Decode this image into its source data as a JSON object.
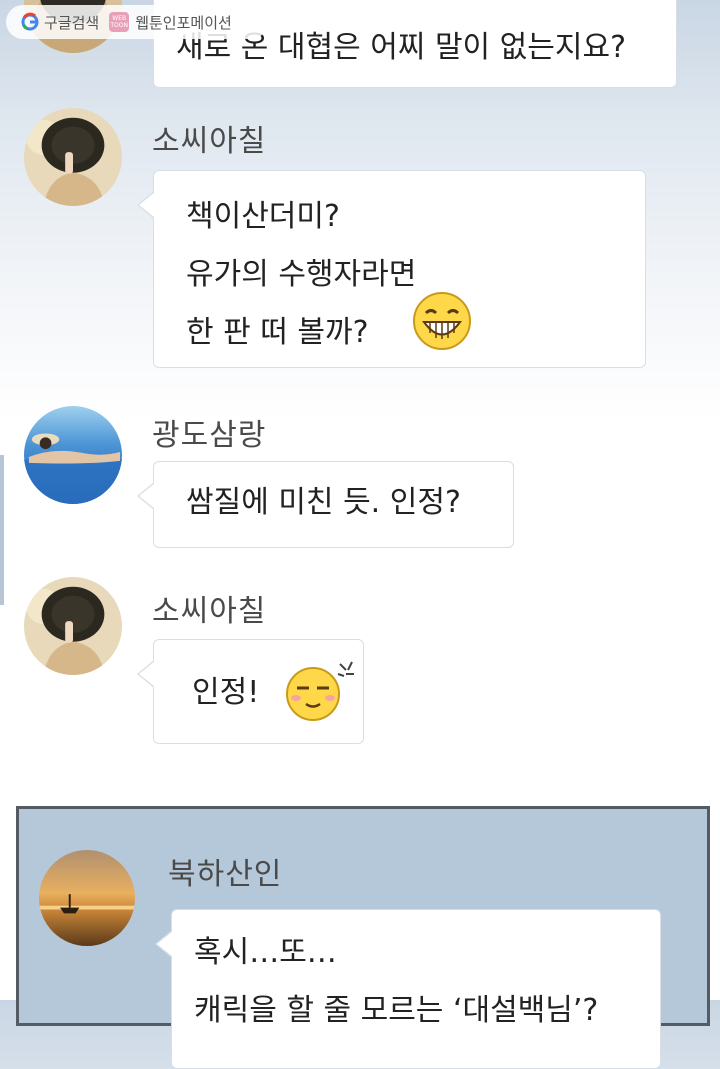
{
  "watermark": {
    "google_label": "구글검색",
    "webtoon_badge": "WEB TOON",
    "brand_label": "웹툰인포메이션"
  },
  "messages": [
    {
      "lines": [
        "새로 온 대협은 어찌 말이 없는지요?"
      ]
    },
    {
      "name": "소씨아칠",
      "lines": [
        "책이산더미?",
        "유가의 수행자라면",
        "한 판  떠 볼까?"
      ],
      "emoticon": "grin-emoji"
    },
    {
      "name": "광도삼랑",
      "lines": [
        "쌈질에 미친 듯. 인정?"
      ]
    },
    {
      "name": "소씨아칠",
      "lines": [
        "인정!"
      ],
      "emoticon": "smug-emoji"
    },
    {
      "name": "북하산인",
      "lines": [
        "혹시…또…",
        "캐릭을 할 줄 모르는 ‘대설백님’?"
      ]
    }
  ],
  "colors": {
    "bubble_border": "#d9dee5",
    "panel_bg": "#b5c8da",
    "panel_border": "#555b62",
    "name_text": "#4a4a4a"
  }
}
